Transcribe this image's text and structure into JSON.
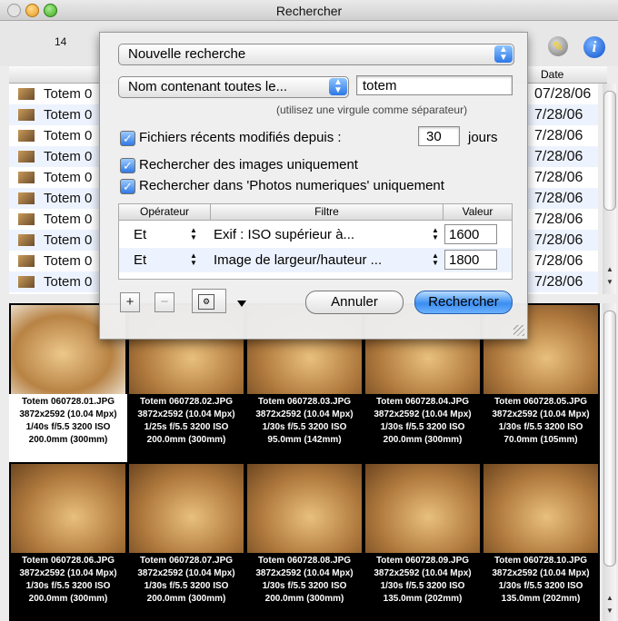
{
  "window": {
    "title": "Rechercher",
    "result_count": "14"
  },
  "toolbar": {
    "icons": [
      "tag-edit-icon",
      "info-icon"
    ]
  },
  "list": {
    "columns": {
      "date": "Date"
    },
    "rows": [
      {
        "name": "Totem 0",
        "date": "07/28/06"
      },
      {
        "name": "Totem 0",
        "date": "7/28/06"
      },
      {
        "name": "Totem 0",
        "date": "7/28/06"
      },
      {
        "name": "Totem 0",
        "date": "7/28/06"
      },
      {
        "name": "Totem 0",
        "date": "7/28/06"
      },
      {
        "name": "Totem 0",
        "date": "7/28/06"
      },
      {
        "name": "Totem 0",
        "date": "7/28/06"
      },
      {
        "name": "Totem 0",
        "date": "7/28/06"
      },
      {
        "name": "Totem 0",
        "date": "7/28/06"
      },
      {
        "name": "Totem 0",
        "date": "7/28/06"
      }
    ]
  },
  "search": {
    "preset": "Nouvelle recherche",
    "criterion": "Nom contenant toutes le...",
    "query": "totem",
    "hint": "(utilisez une virgule comme séparateur)",
    "recent_label": "Fichiers récents modifiés depuis :",
    "recent_days": "30",
    "days_unit": "jours",
    "images_only": "Rechercher des images uniquement",
    "folder_only": "Rechercher dans 'Photos numeriques' uniquement",
    "filters": {
      "headers": {
        "operator": "Opérateur",
        "filter": "Filtre",
        "value": "Valeur"
      },
      "rows": [
        {
          "operator": "Et",
          "filter": "Exif : ISO supérieur à...",
          "value": "1600"
        },
        {
          "operator": "Et",
          "filter": "Image de largeur/hauteur ...",
          "value": "1800"
        }
      ]
    },
    "add": "+",
    "remove": "−",
    "cancel": "Annuler",
    "submit": "Rechercher"
  },
  "grid": [
    {
      "name": "Totem 060728.01.JPG",
      "dims": "3872x2592 (10.04 Mpx)",
      "exposure": "1/40s f/5.5 3200 ISO",
      "focal": "200.0mm (300mm)"
    },
    {
      "name": "Totem 060728.02.JPG",
      "dims": "3872x2592 (10.04 Mpx)",
      "exposure": "1/25s f/5.5 3200 ISO",
      "focal": "200.0mm (300mm)"
    },
    {
      "name": "Totem 060728.03.JPG",
      "dims": "3872x2592 (10.04 Mpx)",
      "exposure": "1/30s f/5.5 3200 ISO",
      "focal": "95.0mm (142mm)"
    },
    {
      "name": "Totem 060728.04.JPG",
      "dims": "3872x2592 (10.04 Mpx)",
      "exposure": "1/30s f/5.5 3200 ISO",
      "focal": "200.0mm (300mm)"
    },
    {
      "name": "Totem 060728.05.JPG",
      "dims": "3872x2592 (10.04 Mpx)",
      "exposure": "1/30s f/5.5 3200 ISO",
      "focal": "70.0mm (105mm)"
    },
    {
      "name": "Totem 060728.06.JPG",
      "dims": "3872x2592 (10.04 Mpx)",
      "exposure": "1/30s f/5.5 3200 ISO",
      "focal": "200.0mm (300mm)"
    },
    {
      "name": "Totem 060728.07.JPG",
      "dims": "3872x2592 (10.04 Mpx)",
      "exposure": "1/30s f/5.5 3200 ISO",
      "focal": "200.0mm (300mm)"
    },
    {
      "name": "Totem 060728.08.JPG",
      "dims": "3872x2592 (10.04 Mpx)",
      "exposure": "1/30s f/5.5 3200 ISO",
      "focal": "200.0mm (300mm)"
    },
    {
      "name": "Totem 060728.09.JPG",
      "dims": "3872x2592 (10.04 Mpx)",
      "exposure": "1/30s f/5.5 3200 ISO",
      "focal": "135.0mm (202mm)"
    },
    {
      "name": "Totem 060728.10.JPG",
      "dims": "3872x2592 (10.04 Mpx)",
      "exposure": "1/30s f/5.5 3200 ISO",
      "focal": "135.0mm (202mm)"
    }
  ]
}
